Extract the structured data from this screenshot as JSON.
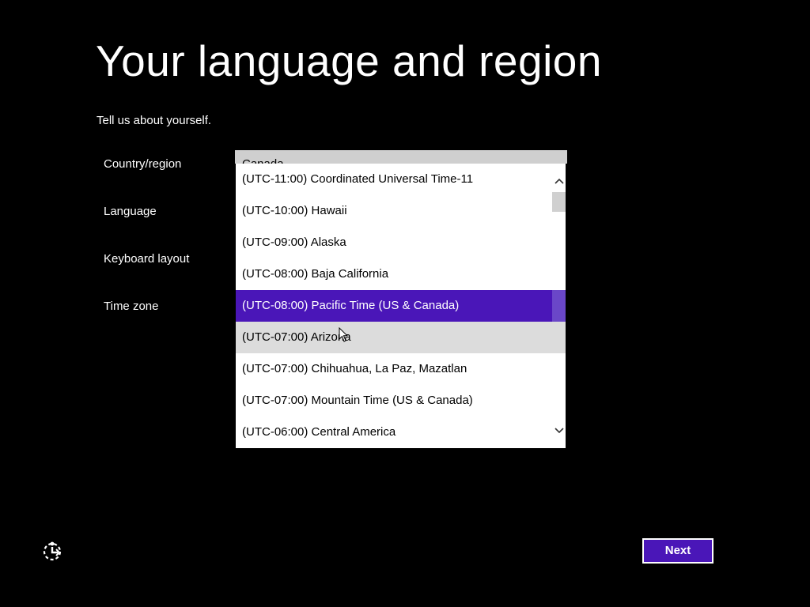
{
  "header": {
    "title": "Your language and region",
    "subtitle": "Tell us about yourself."
  },
  "fields": {
    "country_label": "Country/region",
    "country_value": "Canada",
    "language_label": "Language",
    "keyboard_label": "Keyboard layout",
    "timezone_label": "Time zone"
  },
  "timezone_options": [
    "(UTC-11:00) Coordinated Universal Time-11",
    "(UTC-10:00) Hawaii",
    "(UTC-09:00) Alaska",
    "(UTC-08:00) Baja California",
    "(UTC-08:00) Pacific Time (US & Canada)",
    "(UTC-07:00) Arizona",
    "(UTC-07:00) Chihuahua, La Paz, Mazatlan",
    "(UTC-07:00) Mountain Time (US & Canada)",
    "(UTC-06:00) Central America"
  ],
  "selected_option_index": 4,
  "hovered_option_index": 5,
  "footer": {
    "next_label": "Next",
    "ease_of_access_icon": "ease-of-access-icon"
  },
  "colors": {
    "background": "#000000",
    "accent": "#4a16b8",
    "hover": "#dcdcdc"
  }
}
